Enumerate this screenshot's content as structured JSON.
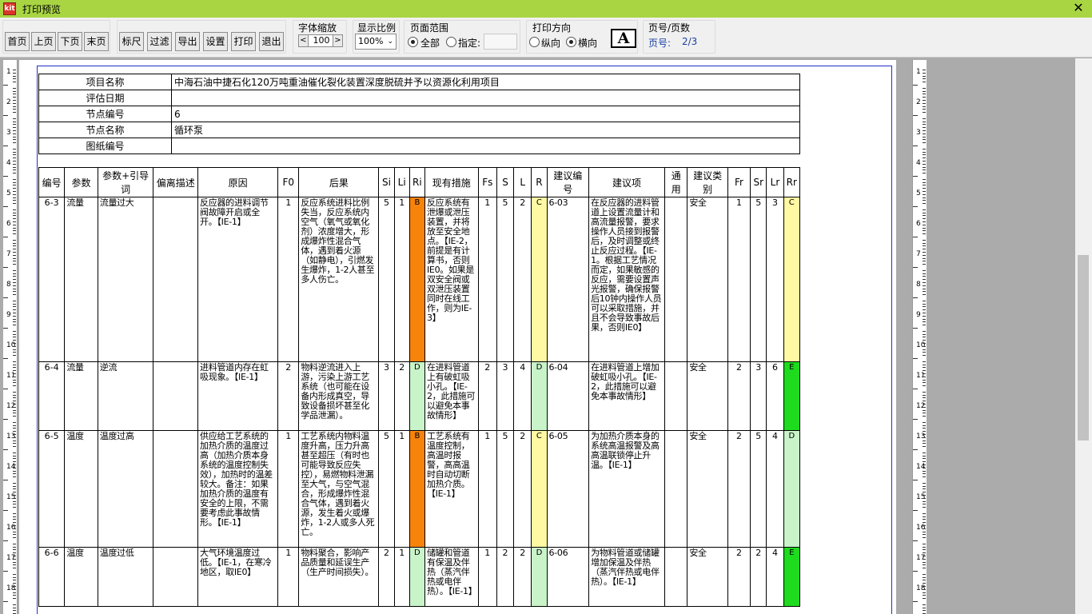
{
  "window": {
    "title": "打印预览",
    "close_label": "✕"
  },
  "toolbar": {
    "nav_buttons": [
      "首页",
      "上页",
      "下页",
      "末页"
    ],
    "action_buttons": [
      "标尺",
      "过滤",
      "导出",
      "设置",
      "打印",
      "退出"
    ],
    "font_zoom": {
      "label": "字体缩放",
      "dec": "<",
      "value": "100",
      "inc": ">"
    },
    "display_ratio": {
      "label": "显示比例",
      "value": "100%"
    },
    "page_range": {
      "label": "页面范围",
      "all": "全部",
      "specified": "指定:",
      "selected": "全部"
    },
    "orientation": {
      "label": "打印方向",
      "portrait": "纵向",
      "landscape": "横向",
      "selected": "横向"
    },
    "font_icon_letter": "A",
    "page_info": {
      "label": "页号/页数",
      "prefix": "页号:",
      "value": "2/3"
    }
  },
  "ruler": {
    "left_numbers": [
      "1",
      "2",
      "3",
      "4",
      "5",
      "6",
      "7",
      "8",
      "9",
      "10",
      "11",
      "12",
      "13",
      "14",
      "15",
      "16",
      "17",
      "18"
    ],
    "right_numbers": [
      "1",
      "2",
      "3",
      "4",
      "5",
      "6",
      "7",
      "8",
      "9",
      "10",
      "11",
      "12",
      "13",
      "14",
      "15",
      "16",
      "17",
      "18"
    ]
  },
  "info_table": [
    {
      "key": "项目名称",
      "value": "中海石油中捷石化120万吨重油催化裂化装置深度脱硫并予以资源化利用项目"
    },
    {
      "key": "评估日期",
      "value": ""
    },
    {
      "key": "节点编号",
      "value": "6"
    },
    {
      "key": "节点名称",
      "value": "循环泵"
    },
    {
      "key": "图纸编号",
      "value": ""
    }
  ],
  "colors": {
    "B": "#f7830b",
    "C": "#fff9a3",
    "D": "#c9f3c9",
    "E": "#1edb1e"
  },
  "main_table": {
    "headers": [
      "编号",
      "参数",
      "参数+引导词",
      "偏离描述",
      "原因",
      "F0",
      "后果",
      "Si",
      "Li",
      "Ri",
      "现有措施",
      "Fs",
      "S",
      "L",
      "R",
      "建议编号",
      "建议项",
      "通用",
      "建议类别",
      "Fr",
      "Sr",
      "Lr",
      "Rr"
    ],
    "rows": [
      {
        "id": "6-3",
        "param": "流量",
        "guide": "流量过大",
        "dev": "",
        "cause": "反应器的进料调节阀故障开启或全开。【IE-1】",
        "f0": "1",
        "consequence": "反应系统进料比例失当，反应系统内空气（氧气或氧化剂）浓度增大，形成爆炸性混合气体，遇到着火源（如静电），引燃发生爆炸，1-2人甚至多人伤亡。",
        "si": "5",
        "li": "1",
        "ri": "B",
        "measures": "反应系统有泄爆或泄压装置，并将放至安全地点。【IE-2，前提是有计算书，否则IE0。如果是双安全阀或双泄压装置同时在线工作，则为IE-3】",
        "fs": "1",
        "s": "5",
        "l": "2",
        "r": "C",
        "sugg_id": "6-03",
        "suggestion": "在反应器的进料管道上设置流量计和高流量报警，要求操作人员接到报警后，及时调整或终止反应过程。【IE-1。根据工艺情况而定，如果敏感的反应，需要设置声光报警，确保报警后10钟内操作人员可以采取措施，并且不会导致事故后果，否则IE0】",
        "common": "",
        "category": "安全",
        "fr": "1",
        "sr": "5",
        "lr": "3",
        "rr": "C"
      },
      {
        "id": "6-4",
        "param": "流量",
        "guide": "逆流",
        "dev": "",
        "cause": "进料管道内存在虹吸现象。【IE-1】",
        "f0": "2",
        "consequence": "物料逆流进入上游，污染上游工艺系统（也可能在设备内形成真空，导致设备损坏甚至化学品泄漏）。",
        "si": "3",
        "li": "2",
        "ri": "D",
        "measures": "在进料管道上有破虹吸小孔。【IE-2，此措施可以避免本事故情形】",
        "fs": "2",
        "s": "3",
        "l": "4",
        "r": "D",
        "sugg_id": "6-04",
        "suggestion": "在进料管道上增加破虹吸小孔。【IE-2，此措施可以避免本事故情形】",
        "common": "",
        "category": "安全",
        "fr": "2",
        "sr": "3",
        "lr": "6",
        "rr": "E"
      },
      {
        "id": "6-5",
        "param": "温度",
        "guide": "温度过高",
        "dev": "",
        "cause": "供应给工艺系统的加热介质的温度过高（加热介质本身系统的温度控制失效），加热时的温差较大。备注：如果加热介质的温度有安全的上限，不需要考虑此事故情形。【IE-1】",
        "f0": "1",
        "consequence": "工艺系统内物料温度升高，压力升高甚至超压（有时也可能导致反应失控），易燃物料泄漏至大气，与空气混合，形成爆炸性混合气体，遇到着火源，发生着火或爆炸，1-2人或多人死亡。",
        "si": "5",
        "li": "1",
        "ri": "B",
        "measures": "工艺系统有温度控制，高温时报警，高高温时自动切断加热介质。【IE-1】",
        "fs": "1",
        "s": "5",
        "l": "2",
        "r": "C",
        "sugg_id": "6-05",
        "suggestion": "为加热介质本身的系统高温报警及高高温联锁停止升温。【IE-1】",
        "common": "",
        "category": "安全",
        "fr": "2",
        "sr": "5",
        "lr": "4",
        "rr": "D"
      },
      {
        "id": "6-6",
        "param": "温度",
        "guide": "温度过低",
        "dev": "",
        "cause": "大气环境温度过低。【IE-1，在寒冷地区，取IE0】",
        "f0": "1",
        "consequence": "物料聚合，影响产品质量和延误生产（生产时间损失）。",
        "si": "2",
        "li": "1",
        "ri": "D",
        "measures": "储罐和管道有保温及伴热（蒸汽伴热或电伴热）。【IE-1】",
        "fs": "1",
        "s": "2",
        "l": "2",
        "r": "D",
        "sugg_id": "6-06",
        "suggestion": "为物料管道或储罐增加保温及伴热（蒸汽伴热或电伴热）。【IE-1】",
        "common": "",
        "category": "安全",
        "fr": "2",
        "sr": "2",
        "lr": "4",
        "rr": "E"
      }
    ]
  }
}
